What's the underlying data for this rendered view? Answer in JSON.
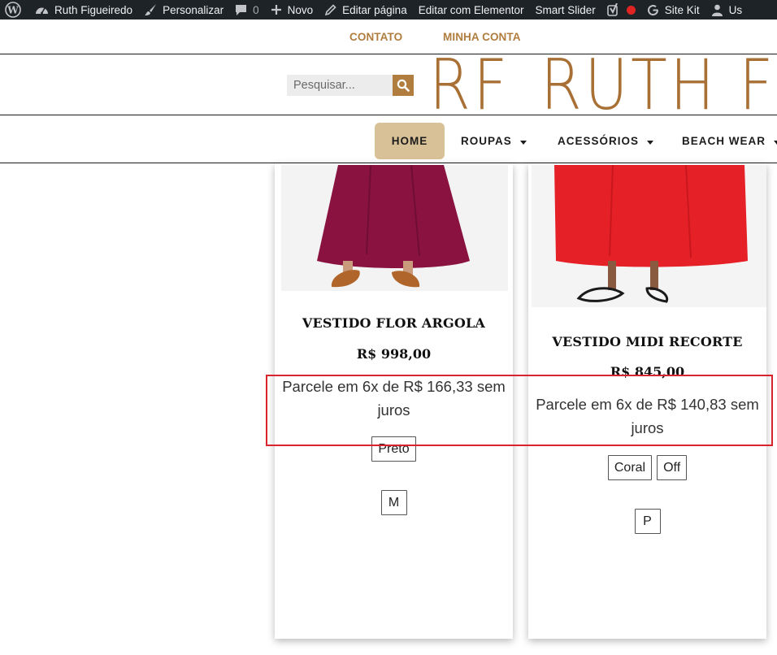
{
  "admin_bar": {
    "site_name": "Ruth Figueiredo",
    "customize": "Personalizar",
    "comments_count": "0",
    "new": "Novo",
    "edit_page": "Editar página",
    "edit_elementor": "Editar com Elementor",
    "smart_slider": "Smart Slider",
    "site_kit": "Site Kit",
    "user_truncated": "Us"
  },
  "top_links": {
    "contact": "CONTATO",
    "account": "MINHA CONTA"
  },
  "search": {
    "placeholder": "Pesquisar..."
  },
  "logo": {
    "mark": "RF",
    "name": "RUTH FI"
  },
  "nav": {
    "items": [
      {
        "label": "HOME",
        "active": true
      },
      {
        "label": "ROUPAS",
        "has_dropdown": true
      },
      {
        "label": "ACESSÓRIOS",
        "has_dropdown": true
      },
      {
        "label": "BEACH WEAR",
        "has_dropdown": true
      }
    ]
  },
  "products": [
    {
      "title": "VESTIDO FLOR ARGOLA",
      "price": "R$ 998,00",
      "installments": "Parcele em 6x de R$ 166,33 sem juros",
      "colors": [
        "Preto"
      ],
      "sizes": [
        "M"
      ]
    },
    {
      "title": "VESTIDO MIDI RECORTE",
      "price": "R$ 845,00",
      "installments": "Parcele em 6x de R$ 140,83 sem juros",
      "colors": [
        "Coral",
        "Off"
      ],
      "sizes": [
        "P"
      ]
    }
  ],
  "theme": {
    "accent": "#b07d3e",
    "nav_active_bg": "#d8c197",
    "admin_bg": "#1d2327",
    "highlight": "#d9232d"
  },
  "icons": {
    "wordpress": "wordpress-icon",
    "dashboard": "dashboard-icon",
    "brush": "brush-icon",
    "comment": "comment-icon",
    "plus": "plus-icon",
    "pencil": "pencil-icon",
    "yoast": "yoast-icon",
    "record": "record-dot-icon",
    "google": "google-g-icon",
    "user": "user-icon",
    "search": "search-icon",
    "caret": "caret-down-icon"
  }
}
